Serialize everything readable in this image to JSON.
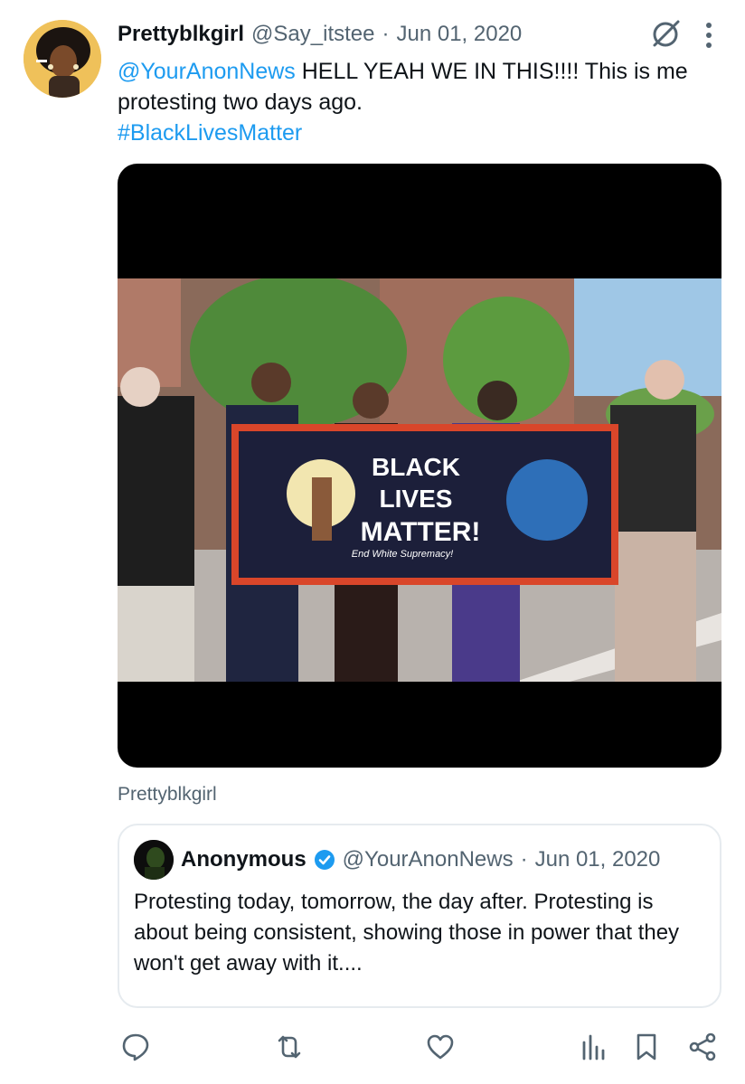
{
  "tweet": {
    "display_name": "Prettyblkgirl",
    "handle": "@Say_itstee",
    "date": "Jun 01, 2020",
    "text_mention": "@YourAnonNews",
    "text_body": " HELL YEAH WE IN THIS!!!! This is me protesting two days ago.",
    "hashtag": "#BlackLivesMatter",
    "media_credit": "Prettyblkgirl",
    "media_banner_line1": "BLACK",
    "media_banner_line2": "LIVES",
    "media_banner_line3": "MATTER!",
    "media_banner_sub": "End White Supremacy!"
  },
  "quote": {
    "display_name": "Anonymous",
    "handle": "@YourAnonNews",
    "date": "Jun 01, 2020",
    "text": "Protesting today, tomorrow, the day after. Protesting is about being consistent, showing those in power that they won't get away with it...."
  },
  "icons": {
    "grok": "grok-icon",
    "more": "more-icon",
    "reply": "reply-icon",
    "retweet": "retweet-icon",
    "like": "heart-icon",
    "views": "views-icon",
    "bookmark": "bookmark-icon",
    "share": "share-icon",
    "verified": "verified-badge-icon"
  },
  "colors": {
    "link": "#1d9bf0",
    "secondary_text": "#536471",
    "primary_text": "#0f1419"
  }
}
